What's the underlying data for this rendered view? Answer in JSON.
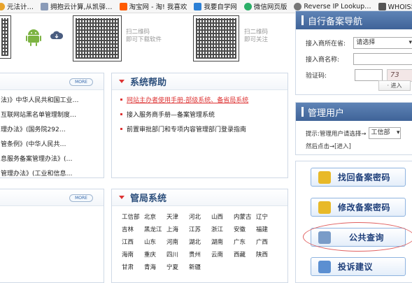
{
  "bookmarks": [
    {
      "label": "元法计…",
      "icon": "clock-icon",
      "color": "#e8a32a"
    },
    {
      "label": "拥抱云计算,从凯驿…",
      "icon": "cloud-icon",
      "color": "#8a9bb8"
    },
    {
      "label": "淘宝网 - 淘! 我喜欢",
      "icon": "taobao-icon",
      "color": "#ff5a00"
    },
    {
      "label": "我要自学网",
      "icon": "monitor-icon",
      "color": "#2b7fd5"
    },
    {
      "label": "微信网页版",
      "icon": "wechat-icon",
      "color": "#2aae67"
    },
    {
      "label": "Reverse IP Lookup…",
      "icon": "globe-icon",
      "color": "#777777"
    },
    {
      "label": "WHOIS域名",
      "icon": "whois-icon",
      "color": "#555555"
    }
  ],
  "qr": {
    "caption1": "扫二维码",
    "caption1b": "即可下载软件",
    "caption2": "扫二维码",
    "caption2b": "即可关注"
  },
  "law_panel": {
    "more": "MORE",
    "items": [
      "法)》中华人民共和国工业…",
      "互联网站黑名单管理制度…",
      "理办法》(国务院292…",
      "管条例》(中华人民共…",
      "息服务备案管理办法》(…",
      "管理办法》(工业和信息…"
    ]
  },
  "help_panel": {
    "title": "系统帮助",
    "items": [
      {
        "text": "网站主办者使用手册-部级系统、备省局系统",
        "highlight": true
      },
      {
        "text": "接入服务商手册—备案管理系统",
        "highlight": false
      },
      {
        "text": "前置审批部门和专项内容管理部门登录指南",
        "highlight": false
      }
    ]
  },
  "more2": "MORE",
  "bureau_panel": {
    "title": "管局系统",
    "provinces": [
      "工信部",
      "北京",
      "天津",
      "河北",
      "山西",
      "内蒙古",
      "辽宁",
      "吉林",
      "黑龙江",
      "上海",
      "江苏",
      "浙江",
      "安徽",
      "福建",
      "江西",
      "山东",
      "河南",
      "湖北",
      "湖南",
      "广东",
      "广西",
      "海南",
      "重庆",
      "四川",
      "贵州",
      "云南",
      "西藏",
      "陕西",
      "甘肃",
      "青海",
      "宁夏",
      "新疆"
    ]
  },
  "navigation": {
    "title": "自行备案导航",
    "province_label": "接入商所在省:",
    "province_value": "请选择",
    "name_label": "接入商名称:",
    "captcha_label": "验证码:",
    "captcha_text": "73",
    "enter_button": "进入"
  },
  "admin": {
    "title": "管理用户",
    "hint_prefix": "提示:管理用户请选择→",
    "select_value": "工信部",
    "hint_suffix": "然后点击→",
    "enter_link": "[进入]"
  },
  "big_buttons": [
    {
      "label": "找回备案密码",
      "icon": "lock-icon",
      "color": "#e8b928"
    },
    {
      "label": "修改备案密码",
      "icon": "lock-edit-icon",
      "color": "#e8b928"
    },
    {
      "label": "公共查询",
      "icon": "search-document-icon",
      "color": "#7a9cc8"
    },
    {
      "label": "投诉建议",
      "icon": "complaint-icon",
      "color": "#5b8fd1"
    }
  ],
  "colors": {
    "accent": "#3f6398",
    "highlight": "#d33333",
    "annotation": "#e06060"
  }
}
